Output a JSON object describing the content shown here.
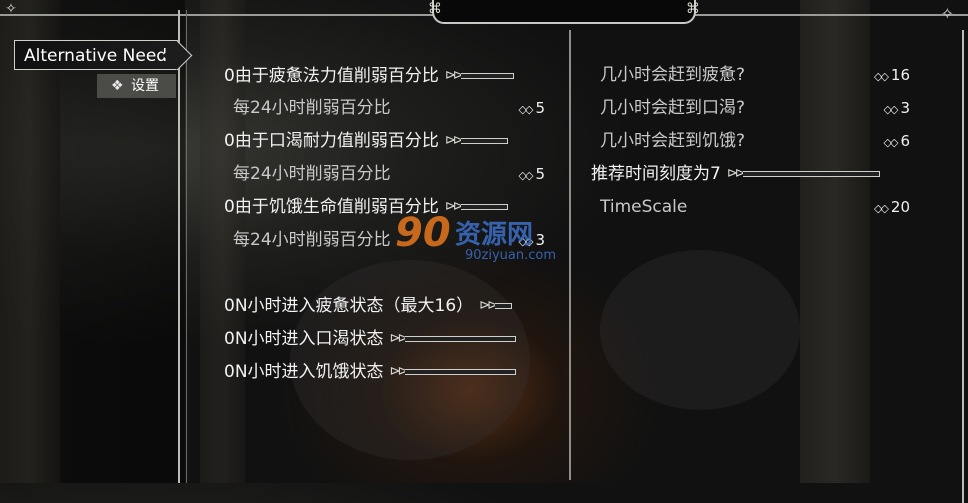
{
  "sidebar": {
    "mod_title": "Alternative Needs",
    "settings_label": "设置",
    "settings_icon": "ornament-icon"
  },
  "left_column": {
    "rows": [
      {
        "label": "0由于疲惫法力值削弱百分比",
        "type": "header"
      },
      {
        "label": "每24小时削弱百分比",
        "value": "5",
        "type": "sub"
      },
      {
        "label": "0由于口渴耐力值削弱百分比",
        "type": "header"
      },
      {
        "label": "每24小时削弱百分比",
        "value": "5",
        "type": "sub"
      },
      {
        "label": "0由于饥饿生命值削弱百分比",
        "type": "header"
      },
      {
        "label": "每24小时削弱百分比",
        "value": "3",
        "type": "sub"
      },
      {
        "label": "0N小时进入疲惫状态（最大16）",
        "type": "header"
      },
      {
        "label": "0N小时进入口渴状态",
        "type": "header"
      },
      {
        "label": "0N小时进入饥饿状态",
        "type": "header"
      }
    ]
  },
  "right_column": {
    "rows": [
      {
        "label": "几小时会赶到疲惫?",
        "value": "16"
      },
      {
        "label": "几小时会赶到口渴?",
        "value": "3"
      },
      {
        "label": "几小时会赶到饥饿?",
        "value": "6"
      },
      {
        "label": "推荐时间刻度为7",
        "type": "header"
      },
      {
        "label": "TimeScale",
        "value": "20"
      }
    ]
  },
  "watermark": {
    "logo": "90",
    "site_name": "资源网",
    "url": "90ziyuan.com"
  },
  "colors": {
    "text": "#f2f2f2",
    "sub_text": "#c9c9c9",
    "frame": "#cfcfcb"
  }
}
